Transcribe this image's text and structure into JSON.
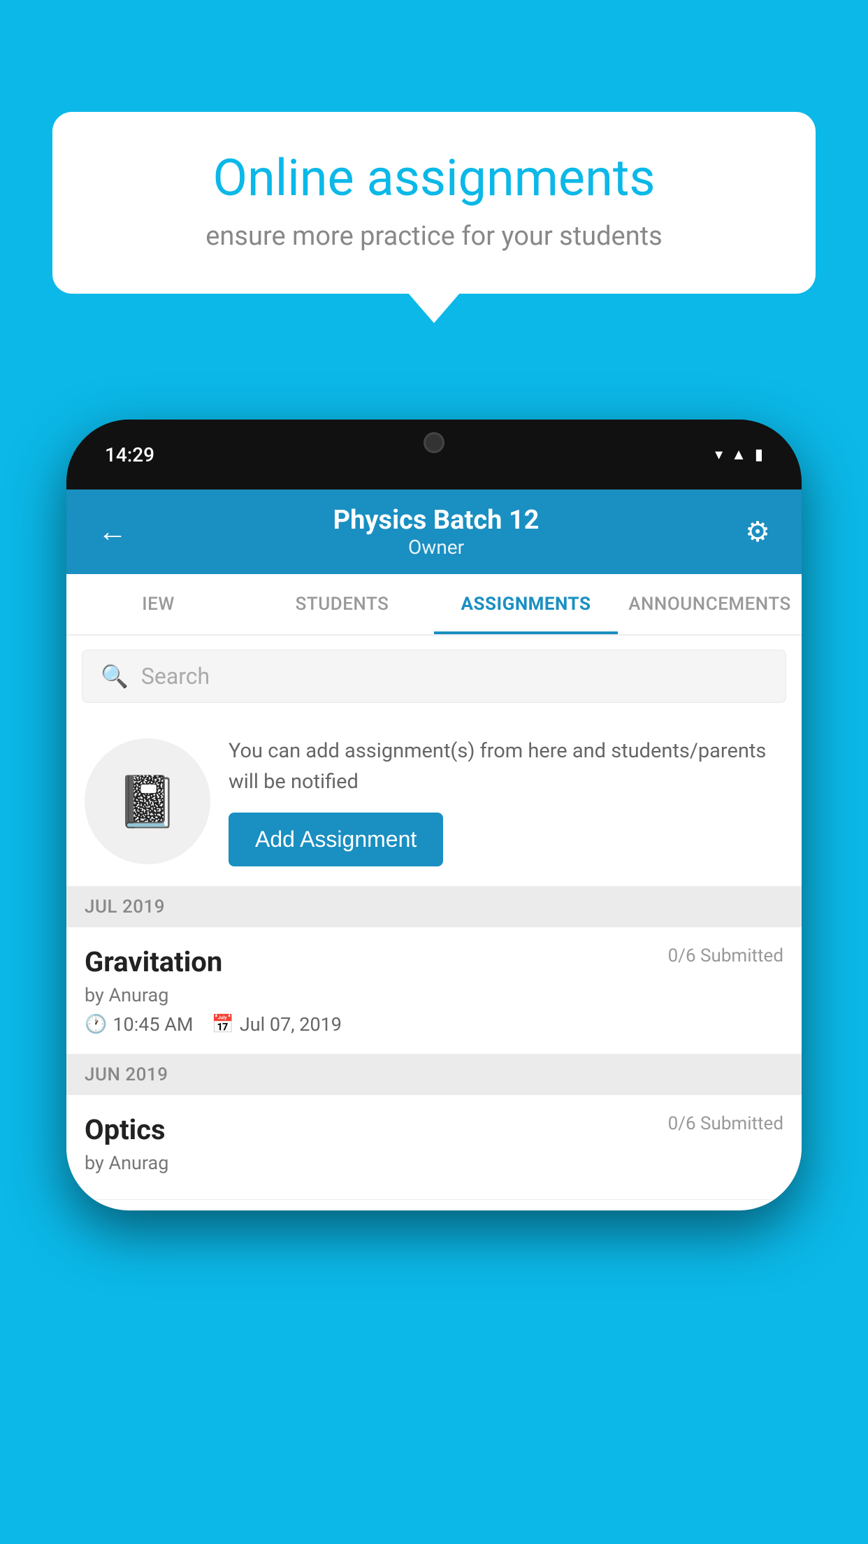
{
  "background_color": "#0bb8e8",
  "speech_bubble": {
    "title": "Online assignments",
    "subtitle": "ensure more practice for your students"
  },
  "status_bar": {
    "time": "14:29",
    "icons": [
      "wifi",
      "signal",
      "battery"
    ]
  },
  "header": {
    "title": "Physics Batch 12",
    "subtitle": "Owner",
    "back_label": "←",
    "settings_label": "⚙"
  },
  "tabs": [
    {
      "label": "IEW",
      "active": false
    },
    {
      "label": "STUDENTS",
      "active": false
    },
    {
      "label": "ASSIGNMENTS",
      "active": true
    },
    {
      "label": "ANNOUNCEMENTS",
      "active": false
    }
  ],
  "search": {
    "placeholder": "Search"
  },
  "promo": {
    "text": "You can add assignment(s) from here and students/parents will be notified",
    "button_label": "Add Assignment"
  },
  "sections": [
    {
      "month": "JUL 2019",
      "assignments": [
        {
          "name": "Gravitation",
          "submitted": "0/6 Submitted",
          "by": "by Anurag",
          "time": "10:45 AM",
          "date": "Jul 07, 2019"
        }
      ]
    },
    {
      "month": "JUN 2019",
      "assignments": [
        {
          "name": "Optics",
          "submitted": "0/6 Submitted",
          "by": "by Anurag",
          "time": "",
          "date": ""
        }
      ]
    }
  ]
}
